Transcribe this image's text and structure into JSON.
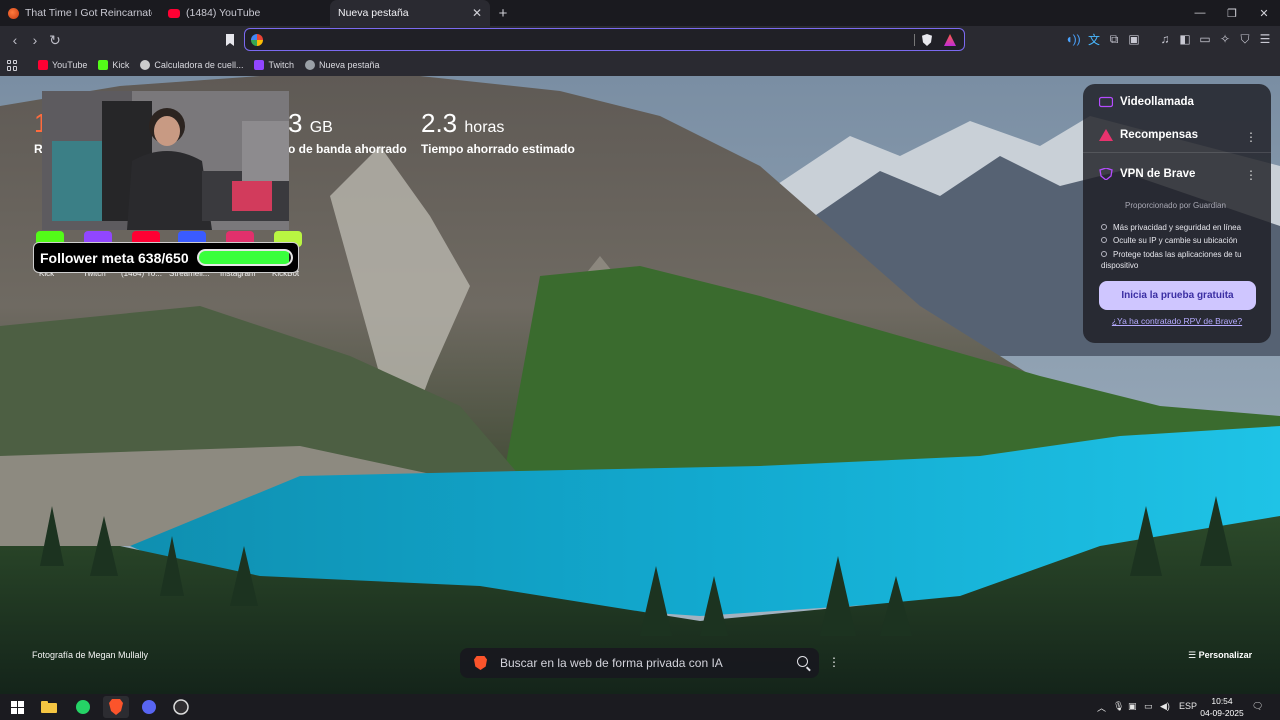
{
  "tabs": [
    {
      "title": "That Time I Got Reincarnated as a Sli",
      "favicon": "crunchyroll-icon"
    },
    {
      "title": "(1484) YouTube",
      "favicon": "youtube-icon"
    },
    {
      "title": "Nueva pestaña",
      "favicon": "",
      "active": true
    }
  ],
  "bookmarks": [
    {
      "label": "YouTube",
      "color": "#ff0033"
    },
    {
      "label": "Kick",
      "color": "#53fc18"
    },
    {
      "label": "Calculadora de cuell...",
      "color": "#cccccc"
    },
    {
      "label": "Twitch",
      "color": "#9146ff"
    },
    {
      "label": "Nueva pestaña",
      "color": "#9aa0a6"
    }
  ],
  "stats": {
    "bandwidth_value": "3",
    "bandwidth_unit": "GB",
    "bandwidth_label": "o de banda ahorrado",
    "time_value": "2.3",
    "time_unit": "horas",
    "time_label": "Tiempo ahorrado estimado",
    "left_partial": "R"
  },
  "overlay": {
    "follower_text": "Follower meta 638/650",
    "follower_progress": 0.98,
    "tiles": [
      {
        "label": "Kick",
        "color": "#53fc18"
      },
      {
        "label": "Twitch",
        "color": "#9146ff"
      },
      {
        "label": "(1484) Yo...",
        "color": "#ff0033"
      },
      {
        "label": "Streameli...",
        "color": "#3a5bff"
      },
      {
        "label": "Instagram",
        "color": "#e1306c"
      },
      {
        "label": "KickBot",
        "color": "#b9f542"
      }
    ]
  },
  "panel": {
    "videocall": "Videollamada",
    "rewards": "Recompensas",
    "vpn_title": "VPN de Brave",
    "powered_by": "Proporcionado por",
    "guardian": "Guardian",
    "features": [
      "Más privacidad y seguridad en línea",
      "Oculte su IP y cambie su ubicación",
      "Protege todas las aplicaciones de tu dispositivo"
    ],
    "trial_button": "Inicia la prueba gratuita",
    "already_link": "¿Ya ha contratado RPV de Brave?"
  },
  "footer": {
    "photo_credit": "Fotografía de Megan Mullally",
    "search_placeholder": "Buscar en la web de forma privada con IA",
    "customize": "Personalizar"
  },
  "taskbar": {
    "lang": "ESP",
    "time": "10:54",
    "date": "04-09-2025"
  },
  "colors": {
    "accent": "#7b6af0",
    "brave_orange": "#fb542b",
    "lake": "#18b4d8"
  }
}
